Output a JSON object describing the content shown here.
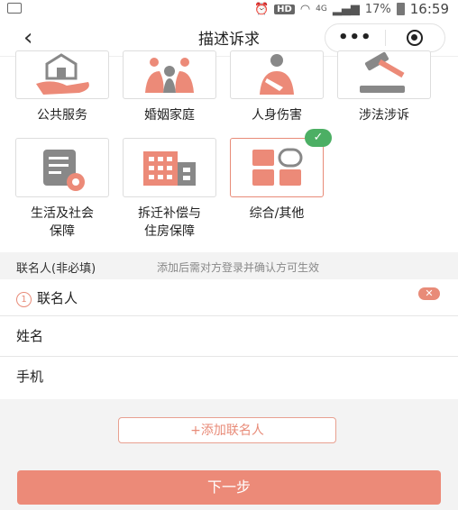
{
  "status_bar": {
    "hd": "HD",
    "network": "4G",
    "battery": "17%",
    "time": "16:59"
  },
  "nav": {
    "back": "‹",
    "title": "描述诉求",
    "more": "•••"
  },
  "categories": [
    {
      "label": "公共服务",
      "icon": "house-hand-icon"
    },
    {
      "label": "婚姻家庭",
      "icon": "family-icon"
    },
    {
      "label": "人身伤害",
      "icon": "injured-person-icon"
    },
    {
      "label": "涉法涉诉",
      "icon": "gavel-icon"
    },
    {
      "label": "生活及社会\n保障",
      "icon": "document-badge-icon"
    },
    {
      "label": "拆迁补偿与\n住房保障",
      "icon": "buildings-icon"
    },
    {
      "label": "综合/其他",
      "icon": "grid-icon",
      "selected": true
    }
  ],
  "contacts": {
    "header": "联名人(非必填)",
    "hint": "添加后需对方登录并确认方可生效",
    "item_number": "1",
    "item_title": "联名人",
    "name_label": "姓名",
    "phone_label": "手机",
    "add_button": "+添加联名人"
  },
  "next_button": "下一步",
  "colors": {
    "accent": "#ec8a78",
    "selected_check": "#4caf64"
  }
}
